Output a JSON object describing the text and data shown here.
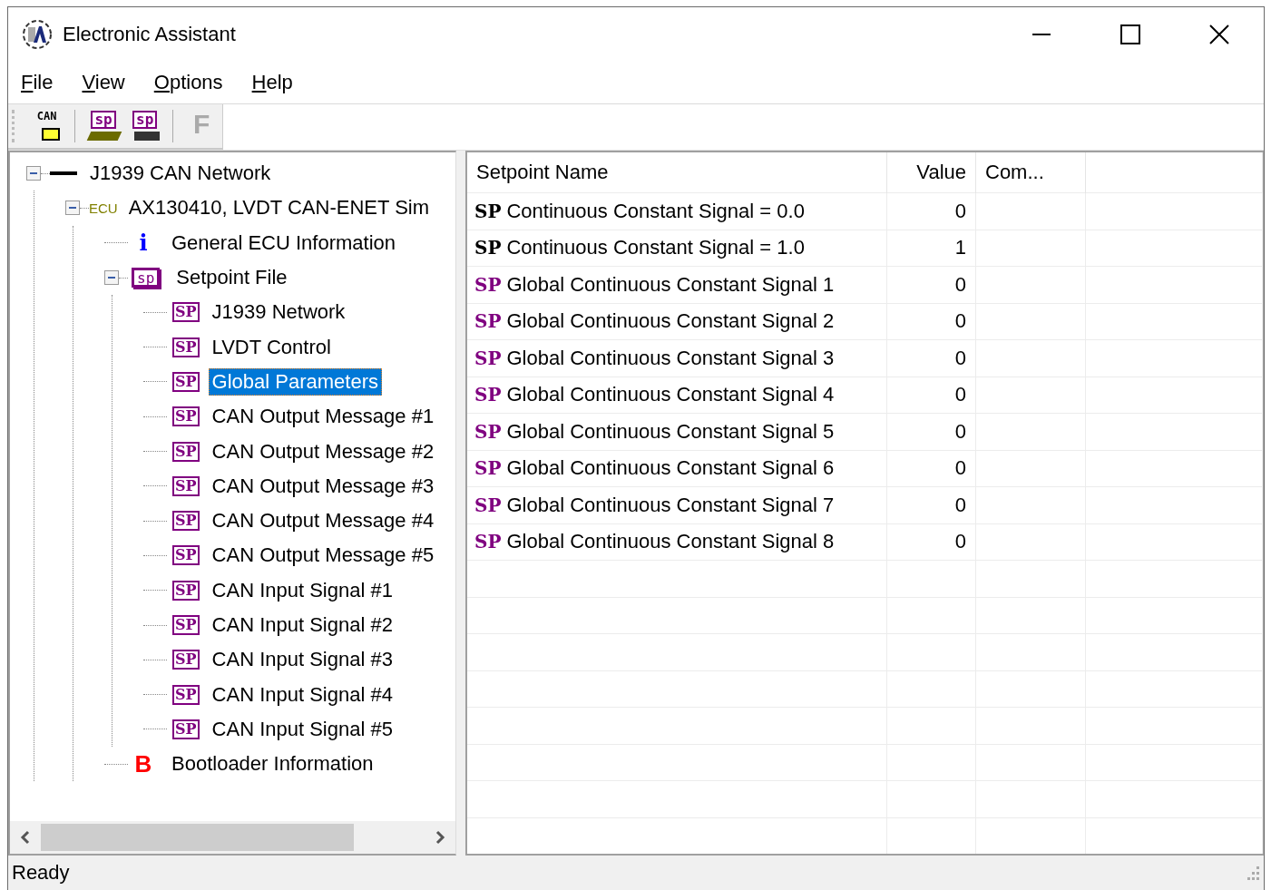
{
  "window": {
    "title": "Electronic Assistant"
  },
  "menu": [
    {
      "label": "File",
      "underline_first": true
    },
    {
      "label": "View",
      "underline_first": true
    },
    {
      "label": "Options",
      "underline_first": true
    },
    {
      "label": "Help",
      "underline_first": true
    }
  ],
  "toolbar": [
    {
      "kind": "can",
      "label": "CAN",
      "disabled": false
    },
    {
      "kind": "open",
      "label": "sp",
      "disabled": false
    },
    {
      "kind": "save",
      "label": "sp",
      "disabled": false
    },
    {
      "kind": "flash",
      "label": "F",
      "disabled": true
    }
  ],
  "tree": [
    {
      "label": "J1939 CAN Network",
      "kind": "network",
      "expanded": true,
      "selected": false,
      "children": [
        {
          "label": "AX130410, LVDT CAN-ENET Sim",
          "kind": "ecu",
          "icon_text": "ECU",
          "expanded": true,
          "selected": false,
          "children": [
            {
              "label": "General ECU Information",
              "kind": "info",
              "icon_text": "i",
              "selected": false
            },
            {
              "label": "Setpoint File",
              "kind": "setpoint-file",
              "icon_text": "sp",
              "expanded": true,
              "selected": false,
              "children": [
                {
                  "label": "J1939 Network",
                  "kind": "setpoint",
                  "icon_text": "SP",
                  "selected": false
                },
                {
                  "label": "LVDT Control",
                  "kind": "setpoint",
                  "icon_text": "SP",
                  "selected": false
                },
                {
                  "label": "Global Parameters",
                  "kind": "setpoint",
                  "icon_text": "SP",
                  "selected": true
                },
                {
                  "label": "CAN Output Message #1",
                  "kind": "setpoint",
                  "icon_text": "SP",
                  "selected": false
                },
                {
                  "label": "CAN Output Message #2",
                  "kind": "setpoint",
                  "icon_text": "SP",
                  "selected": false
                },
                {
                  "label": "CAN Output Message #3",
                  "kind": "setpoint",
                  "icon_text": "SP",
                  "selected": false
                },
                {
                  "label": "CAN Output Message #4",
                  "kind": "setpoint",
                  "icon_text": "SP",
                  "selected": false
                },
                {
                  "label": "CAN Output Message #5",
                  "kind": "setpoint",
                  "icon_text": "SP",
                  "selected": false
                },
                {
                  "label": "CAN Input Signal #1",
                  "kind": "setpoint",
                  "icon_text": "SP",
                  "selected": false
                },
                {
                  "label": "CAN Input Signal #2",
                  "kind": "setpoint",
                  "icon_text": "SP",
                  "selected": false
                },
                {
                  "label": "CAN Input Signal #3",
                  "kind": "setpoint",
                  "icon_text": "SP",
                  "selected": false
                },
                {
                  "label": "CAN Input Signal #4",
                  "kind": "setpoint",
                  "icon_text": "SP",
                  "selected": false
                },
                {
                  "label": "CAN Input Signal #5",
                  "kind": "setpoint",
                  "icon_text": "SP",
                  "selected": false
                }
              ]
            },
            {
              "label": "Bootloader Information",
              "kind": "bootloader",
              "icon_text": "B",
              "selected": false
            }
          ]
        }
      ]
    }
  ],
  "table": {
    "columns": [
      "Setpoint Name",
      "Value",
      "Com..."
    ],
    "rows": [
      {
        "icon_text": "SP",
        "color": "#000000",
        "name": "Continuous Constant Signal = 0.0",
        "value": "0"
      },
      {
        "icon_text": "SP",
        "color": "#000000",
        "name": "Continuous Constant Signal = 1.0",
        "value": "1"
      },
      {
        "icon_text": "SP",
        "color": "#800080",
        "name": "Global Continuous Constant Signal 1",
        "value": "0"
      },
      {
        "icon_text": "SP",
        "color": "#800080",
        "name": "Global Continuous Constant Signal 2",
        "value": "0"
      },
      {
        "icon_text": "SP",
        "color": "#800080",
        "name": "Global Continuous Constant Signal 3",
        "value": "0"
      },
      {
        "icon_text": "SP",
        "color": "#800080",
        "name": "Global Continuous Constant Signal 4",
        "value": "0"
      },
      {
        "icon_text": "SP",
        "color": "#800080",
        "name": "Global Continuous Constant Signal 5",
        "value": "0"
      },
      {
        "icon_text": "SP",
        "color": "#800080",
        "name": "Global Continuous Constant Signal 6",
        "value": "0"
      },
      {
        "icon_text": "SP",
        "color": "#800080",
        "name": "Global Continuous Constant Signal 7",
        "value": "0"
      },
      {
        "icon_text": "SP",
        "color": "#800080",
        "name": "Global Continuous Constant Signal 8",
        "value": "0"
      }
    ]
  },
  "status_bar": {
    "text": "Ready"
  }
}
